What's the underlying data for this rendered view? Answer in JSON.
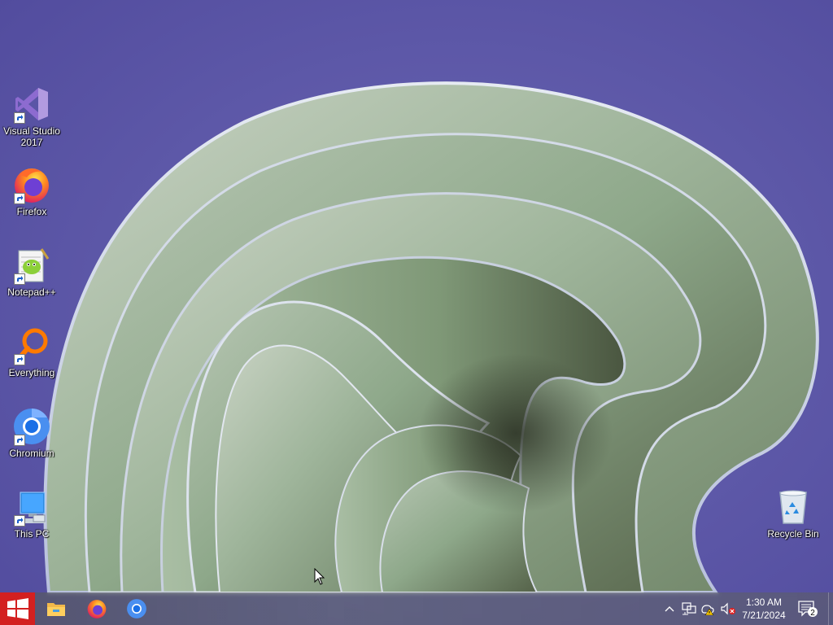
{
  "desktop": {
    "icons": [
      {
        "id": "vs",
        "label": "Visual Studio\n2017"
      },
      {
        "id": "firefox",
        "label": "Firefox"
      },
      {
        "id": "notepadpp",
        "label": "Notepad++"
      },
      {
        "id": "everything",
        "label": "Everything"
      },
      {
        "id": "chromium",
        "label": "Chromium"
      },
      {
        "id": "thispc",
        "label": "This PC"
      },
      {
        "id": "recyclebin",
        "label": "Recycle Bin"
      }
    ]
  },
  "taskbar": {
    "start": "start-icon",
    "pinned": [
      "file-explorer-icon",
      "firefox-icon",
      "chromium-icon"
    ],
    "tray": {
      "icons": [
        "chevron-up-icon",
        "network-icon",
        "warning-shield-icon",
        "volume-muted-icon"
      ],
      "time": "1:30 AM",
      "date": "7/21/2024",
      "notification_count": "2"
    }
  },
  "colors": {
    "background": "#5a55a6",
    "start_accent": "#d32020",
    "wallpaper_ribbon": "#8fae8e"
  }
}
